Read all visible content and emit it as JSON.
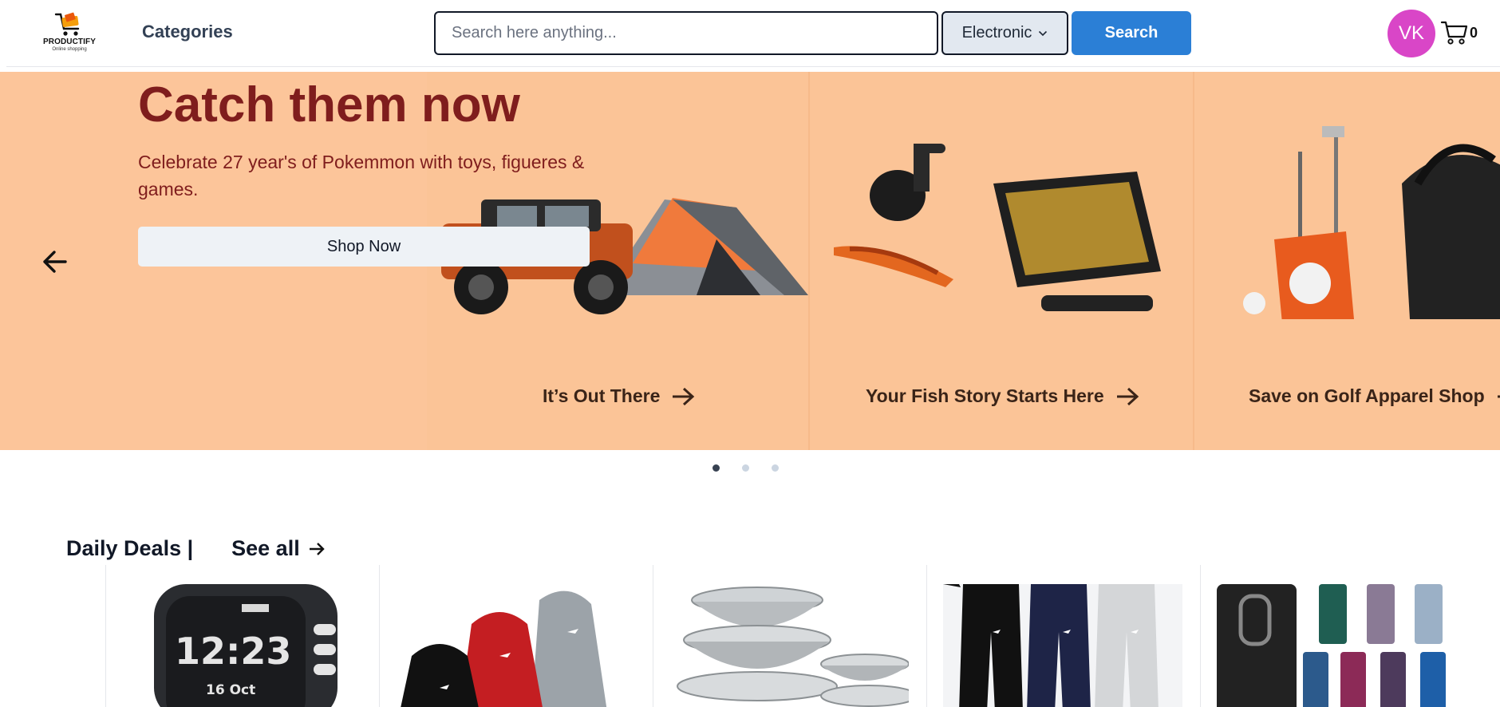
{
  "header": {
    "logo_name": "PRODUCTIFY",
    "logo_tagline": "Online shopping",
    "categories_label": "Categories",
    "search_placeholder": "Search here anything...",
    "category_select": "Electronic",
    "search_button": "Search",
    "avatar_initials": "VK",
    "cart_count": "0"
  },
  "hero": {
    "title": "Catch them now",
    "subtitle": "Celebrate 27 year's of Pokemmon with toys, figueres & games.",
    "cta": "Shop Now",
    "panels": [
      {
        "caption": "It’s Out There"
      },
      {
        "caption": "Your Fish Story Starts Here"
      },
      {
        "caption": "Save on Golf Apparel Shop"
      }
    ],
    "dots": 3,
    "active_dot": 0
  },
  "deals": {
    "title": "Daily Deals |",
    "see_all": "See all",
    "watch_time": "12:23",
    "watch_date": "16 Oct",
    "items": [
      "smart-watch",
      "hoodies",
      "steel-bowls",
      "jogger-pants",
      "tumblers"
    ]
  },
  "colors": {
    "hero_bg": "#fcc59a",
    "hero_text": "#7f1d1d",
    "search_button": "#2b7fd6",
    "avatar": "#d946c7"
  }
}
